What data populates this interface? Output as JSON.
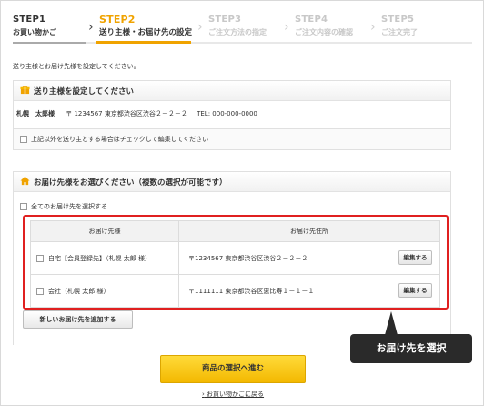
{
  "steps": [
    {
      "num": "STEP1",
      "label": "お買い物かご"
    },
    {
      "num": "STEP2",
      "label": "送り主様・お届け先の設定"
    },
    {
      "num": "STEP3",
      "label": "ご注文方法の指定"
    },
    {
      "num": "STEP4",
      "label": "ご注文内容の確認"
    },
    {
      "num": "STEP5",
      "label": "ご注文完了"
    }
  ],
  "intro_text": "送り主様とお届け先様を設定してください。",
  "sender_section": {
    "title": "送り主様を設定してください",
    "name": "札幌　太郎様",
    "postal": "〒 1234567 東京都渋谷区渋谷２－２－２",
    "tel": "TEL: 000-000-0000",
    "checkbox_label": "上記以外を送り主とする場合はチェックして編集してください"
  },
  "recipient_section": {
    "title": "お届け先様をお選びください（複数の選択が可能です）",
    "select_all_label": "全てのお届け先を選択する",
    "columns": [
      "お届け先様",
      "お届け先住所"
    ],
    "rows": [
      {
        "name": "自宅【会員登録先】（札幌 太郎 様）",
        "address": "〒1234567 東京都渋谷区渋谷２－２－２",
        "button": "編集する"
      },
      {
        "name": "会社（札幌 太郎 様）",
        "address": "〒1111111 東京都渋谷区恵比寿１－１－１",
        "button": "編集する"
      }
    ],
    "add_button": "新しいお届け先を追加する"
  },
  "callout_text": "お届け先を選択",
  "proceed_button": "商品の選択へ進む",
  "back_link": "お買い物かごに戻る",
  "colors": {
    "accent": "#f0a300",
    "highlight": "#e02020",
    "callout_bg": "#2a2a2a"
  }
}
